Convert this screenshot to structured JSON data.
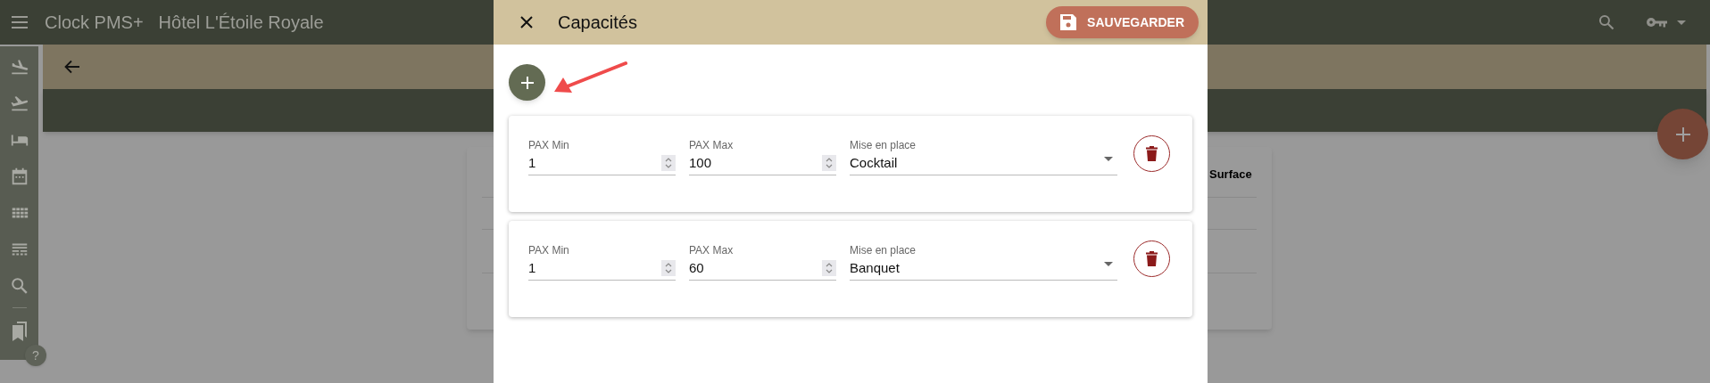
{
  "app_bar": {
    "app_name": "Clock PMS+",
    "hotel_name": "Hôtel L'Étoile Royale"
  },
  "help_badge": "?",
  "background_table": {
    "header": "Surface"
  },
  "dialog": {
    "title": "Capacités",
    "save_button": "SAUVEGARDER",
    "capacities": [
      {
        "pax_min_label": "PAX Min",
        "pax_min": "1",
        "pax_max_label": "PAX Max",
        "pax_max": "100",
        "setup_label": "Mise en place",
        "setup": "Cocktail"
      },
      {
        "pax_min_label": "PAX Min",
        "pax_min": "1",
        "pax_max_label": "PAX Max",
        "pax_max": "60",
        "setup_label": "Mise en place",
        "setup": "Banquet"
      }
    ]
  }
}
